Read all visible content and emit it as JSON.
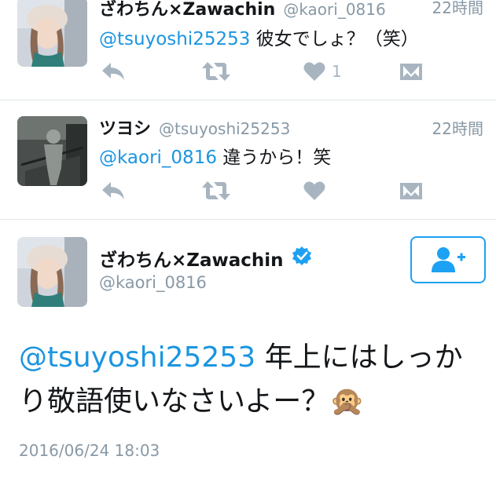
{
  "timeline": [
    {
      "name": "ざわちん×Zawachin",
      "handle": "@kaori_0816",
      "time": "22時間",
      "mention": "@tsuyoshi25253",
      "text": " 彼女でしょ？（笑）",
      "like_count": "1"
    },
    {
      "name": "ツヨシ",
      "handle": "@tsuyoshi25253",
      "time": "22時間",
      "mention": "@kaori_0816",
      "text": " 違うから！笑",
      "like_count": ""
    }
  ],
  "main_tweet": {
    "name": "ざわちん×Zawachin",
    "handle": "@kaori_0816",
    "mention": "@tsuyoshi25253",
    "text_line1": " 年上にはしっか",
    "text_line2": "り敬語使いなさいよー？",
    "emoji": "🙊",
    "date": "2016/06/24 18:03"
  },
  "icons": {
    "reply": "reply-icon",
    "retweet": "retweet-icon",
    "like": "heart-icon",
    "message": "direct-message-icon",
    "follow": "add-user-icon",
    "verified": "verified-badge-icon"
  },
  "colors": {
    "link": "#1b95e0",
    "action_gray": "#a8b5c0",
    "follow_blue": "#1da1f2"
  }
}
